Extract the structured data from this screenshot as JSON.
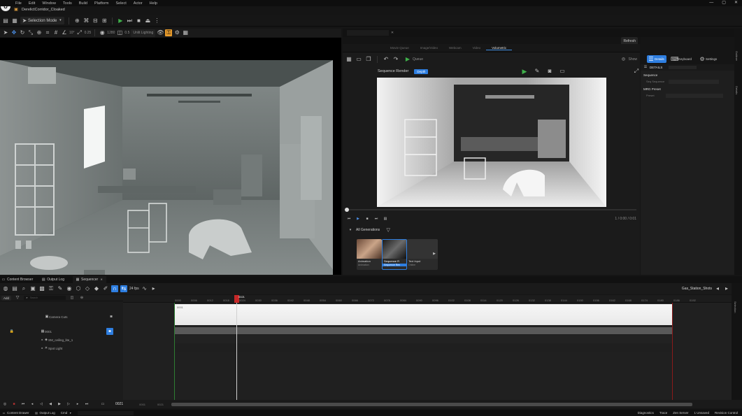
{
  "menubar": {
    "items": [
      "File",
      "Edit",
      "Window",
      "Tools",
      "Build",
      "Platform",
      "Select",
      "Actor",
      "Help"
    ],
    "window_controls": [
      "—",
      "▢",
      "✕"
    ]
  },
  "document_tab": {
    "label": "DerelictCorridor_Cloaked"
  },
  "toolbar": {
    "mode_label": "Selection Mode"
  },
  "viewport_toolbar": {
    "snap_angle": "10°",
    "snap_scale": "0.25",
    "res_label": "1280",
    "scale_label": "0.5",
    "view_mode": "Unlit Lighting"
  },
  "right_tab_label": "",
  "refresh_label": "Refresh",
  "mrq": {
    "tabs": [
      "Movie Queue",
      "Image/Video",
      "Webcam",
      "Video",
      "Volumetric"
    ],
    "active_tab": "Volumetric",
    "queue_label": "Queue",
    "title": "Sequence Render",
    "badge": "Depth",
    "show_label": "Show",
    "details_label": "Details",
    "keyboard_label": "Keyboard",
    "settings_label": "Settings",
    "timecode": "1 / 0:00 / 0:01",
    "all_generations_label": "All Generations",
    "gen_cards": [
      {
        "title": "Animation",
        "sub": "Animation"
      },
      {
        "title": "Sequence R",
        "sub": "Sequence Ren"
      },
      {
        "title": "Text Input",
        "sub": "Online"
      }
    ]
  },
  "details": {
    "tab_label": "DETAILS",
    "section_sequence": "Sequence",
    "field_seq_label": "Seq Sequence",
    "section_mrg": "MRG Preset",
    "field_preset_label": "Preset"
  },
  "bottom_tabs": [
    "Content Browser",
    "Output Log",
    "Sequencer"
  ],
  "sequencer": {
    "fps_label": "24 fps",
    "sequence_name": "Gas_Station_Shots",
    "add_label": "Add",
    "search_placeholder": "Search",
    "current_frame": "0021",
    "start_frame": "0001",
    "end_frame": "0021",
    "playhead_label": "0021",
    "section_label": "0001",
    "tracks": [
      {
        "label": "Camera Cuts",
        "indent": 0
      },
      {
        "label": "0001",
        "indent": 0
      },
      {
        "label": "SM_ceiling_lite_1",
        "indent": 1
      },
      {
        "label": "Spot Light",
        "indent": 1
      }
    ],
    "ruler": [
      "0000",
      "0006",
      "0012",
      "0018",
      "0024",
      "0030",
      "0036",
      "0042",
      "0048",
      "0054",
      "0060",
      "0066",
      "0072",
      "0078",
      "0084",
      "0090",
      "0096",
      "0102",
      "0108",
      "0114",
      "0120",
      "0126",
      "0132",
      "0138",
      "0144",
      "0150",
      "0156",
      "0162",
      "0168",
      "0174",
      "0180",
      "0186",
      "0192"
    ]
  },
  "statusbar": {
    "left": [
      "Content Drawer",
      "Output Log",
      "Cmd"
    ],
    "right": [
      "Diagnostics",
      "Trace",
      "Zen Server",
      "1 Unsaved",
      "Revision Control"
    ]
  },
  "side_labels": {
    "outliner": "Outliner",
    "details": "Details",
    "selection": "Selection"
  },
  "colors": {
    "accent": "#2e7ee0",
    "play_green": "#3fb04a",
    "orange": "#e89b2b",
    "playhead": "#c62828"
  }
}
